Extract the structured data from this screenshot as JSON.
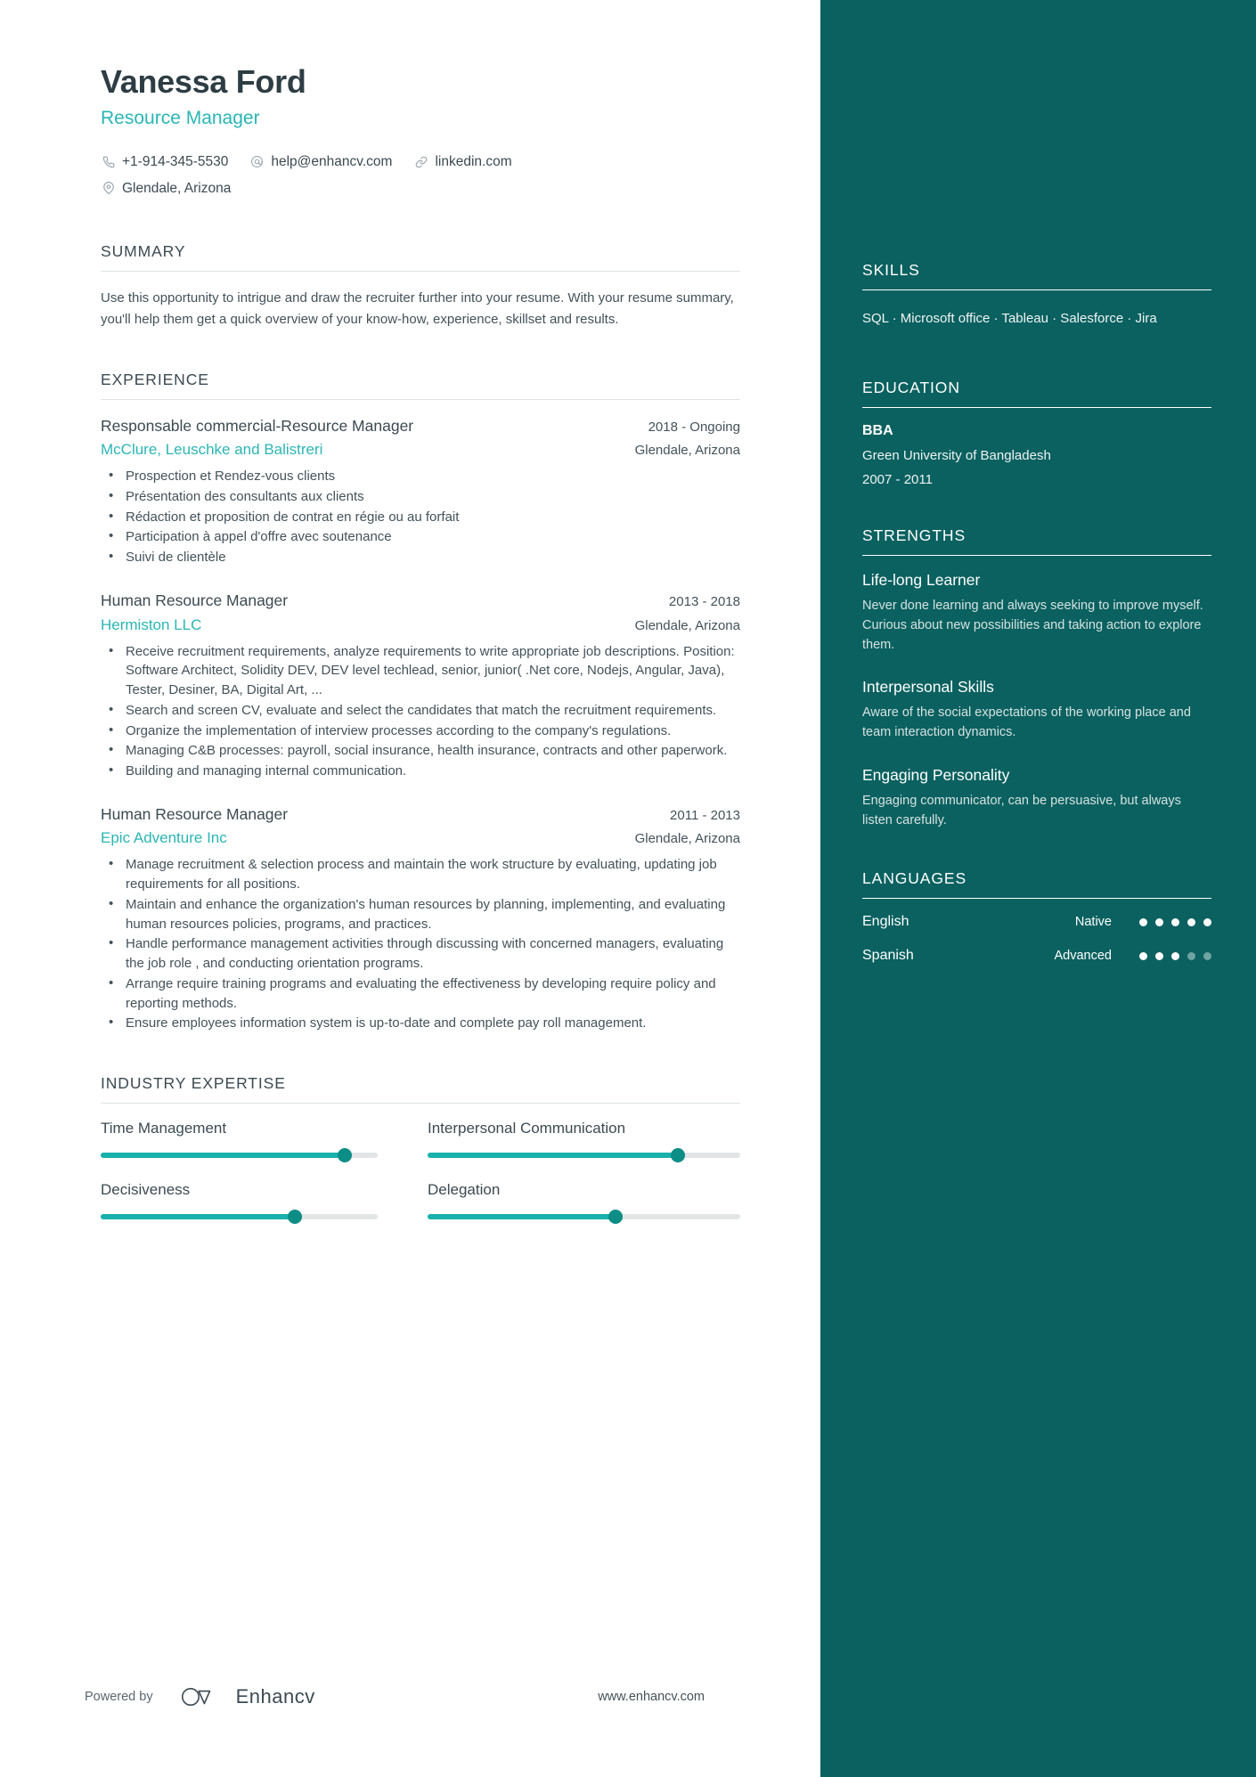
{
  "header": {
    "name": "Vanessa Ford",
    "title": "Resource Manager",
    "contacts": [
      {
        "icon": "phone-icon",
        "text": "+1-914-345-5530"
      },
      {
        "icon": "email-icon",
        "text": "help@enhancv.com"
      },
      {
        "icon": "link-icon",
        "text": "linkedin.com"
      }
    ],
    "location": {
      "icon": "location-pin-icon",
      "text": "Glendale, Arizona"
    }
  },
  "summary": {
    "heading": "SUMMARY",
    "text": "Use this opportunity to intrigue and draw the recruiter further into your resume. With your resume summary, you'll help them get a quick overview of your know-how, experience, skillset and results."
  },
  "experience": {
    "heading": "EXPERIENCE",
    "entries": [
      {
        "role": "Responsable commercial-Resource Manager",
        "dates": "2018 - Ongoing",
        "company": "McClure, Leuschke and Balistreri",
        "location": "Glendale, Arizona",
        "bullets": [
          "Prospection et Rendez-vous clients",
          "Présentation des consultants aux clients",
          "Rédaction et proposition de contrat en régie ou au forfait",
          "Participation à appel d'offre avec soutenance",
          "Suivi de clientèle"
        ]
      },
      {
        "role": "Human Resource Manager",
        "dates": "2013 - 2018",
        "company": "Hermiston LLC",
        "location": "Glendale, Arizona",
        "bullets": [
          "Receive recruitment requirements, analyze requirements to write appropriate job descriptions. Position: Software Architect, Solidity DEV,  DEV level techlead, senior, junior( .Net core, Nodejs, Angular, Java), Tester, Desiner, BA, Digital Art, ...",
          "Search and screen CV, evaluate and select the candidates that match the recruitment requirements.",
          "Organize the implementation of interview processes according to the company's regulations.",
          "Managing C&B processes: payroll, social insurance, health insurance, contracts and other paperwork.",
          "Building and managing internal communication."
        ]
      },
      {
        "role": "Human Resource Manager",
        "dates": "2011 - 2013",
        "company": "Epic Adventure Inc",
        "location": "Glendale, Arizona",
        "bullets": [
          "Manage recruitment &  selection process and maintain the work structure by evaluating, updating job requirements for all positions.",
          "Maintain and enhance the organization's human resources by planning, implementing, and evaluating human resources policies, programs, and practices.",
          "Handle performance management activities through discussing with concerned managers, evaluating the job role , and conducting orientation programs.",
          "Arrange require training programs and evaluating the effectiveness by developing require policy and reporting methods.",
          "Ensure employees information system is up-to-date and complete pay roll management."
        ]
      }
    ]
  },
  "industry_expertise": {
    "heading": "INDUSTRY EXPERTISE",
    "items": [
      {
        "label": "Time Management",
        "value": 88
      },
      {
        "label": "Interpersonal Communication",
        "value": 80
      },
      {
        "label": "Decisiveness",
        "value": 70
      },
      {
        "label": "Delegation",
        "value": 60
      }
    ]
  },
  "footer": {
    "powered_by": "Powered by",
    "brand": "Enhancv",
    "url": "www.enhancv.com"
  },
  "sidebar": {
    "skills": {
      "heading": "SKILLS",
      "text": "SQL · Microsoft office · Tableau · Salesforce · Jira"
    },
    "education": {
      "heading": "EDUCATION",
      "degree": "BBA",
      "school": "Green University of Bangladesh",
      "dates": "2007 - 2011"
    },
    "strengths": {
      "heading": "STRENGTHS",
      "items": [
        {
          "title": "Life-long Learner",
          "desc": "Never done learning and always seeking to improve myself. Curious about new possibilities and taking action to explore them."
        },
        {
          "title": "Interpersonal Skills",
          "desc": "Aware of the social expectations of the working place and team interaction dynamics."
        },
        {
          "title": "Engaging Personality",
          "desc": "Engaging communicator, can be persuasive, but always listen carefully."
        }
      ]
    },
    "languages": {
      "heading": "LANGUAGES",
      "items": [
        {
          "name": "English",
          "level": "Native",
          "dots_filled": 5,
          "dots_total": 5
        },
        {
          "name": "Spanish",
          "level": "Advanced",
          "dots_filled": 3,
          "dots_total": 5
        }
      ]
    }
  },
  "colors": {
    "accent_teal": "#2cb5b5",
    "sidebar_bg": "#0a6160",
    "bar_fill": "#18b1ab",
    "text_dark": "#3c4a52"
  }
}
